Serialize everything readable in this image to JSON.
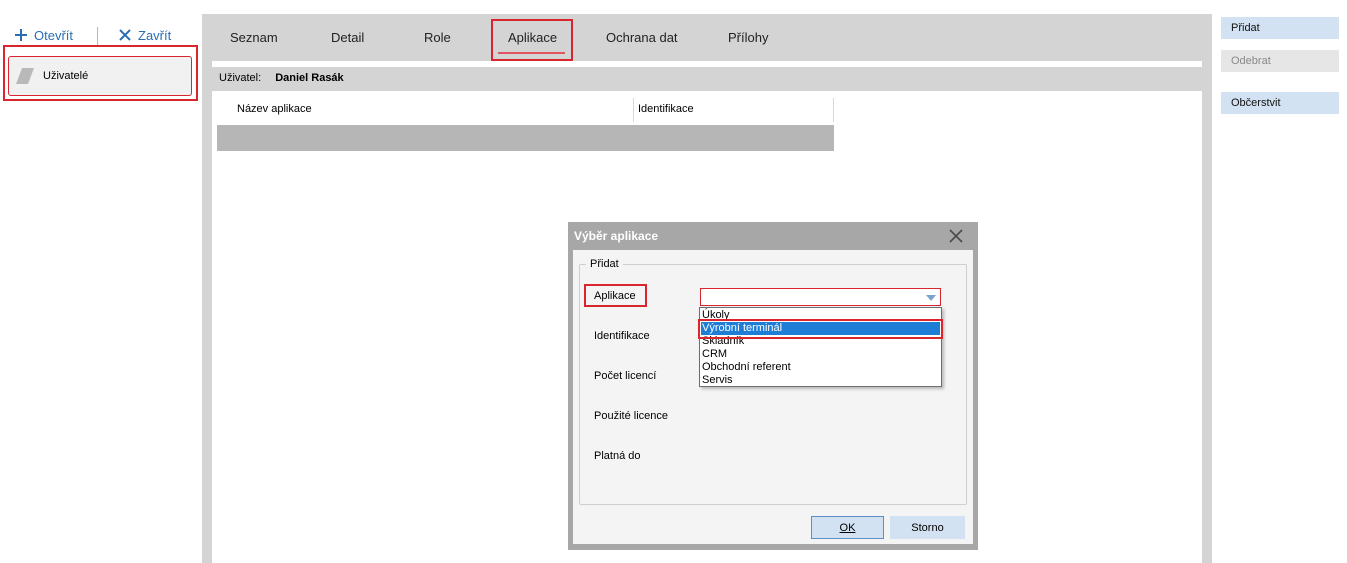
{
  "toolbar": {
    "open_label": "Otevřít",
    "close_label": "Zavřít"
  },
  "sidebar": {
    "items": [
      {
        "label": "Uživatelé",
        "selected": true
      }
    ]
  },
  "tabs": [
    {
      "label": "Seznam",
      "active": false
    },
    {
      "label": "Detail",
      "active": false
    },
    {
      "label": "Role",
      "active": false
    },
    {
      "label": "Aplikace",
      "active": true
    },
    {
      "label": "Ochrana dat",
      "active": false
    },
    {
      "label": "Přílohy",
      "active": false
    }
  ],
  "user_bar": {
    "label": "Uživatel:",
    "name": "Daniel Rasák"
  },
  "grid": {
    "columns": [
      "Název aplikace",
      "Identifikace"
    ]
  },
  "right_panel": {
    "add_label": "Přidat",
    "remove_label": "Odebrat",
    "refresh_label": "Občerstvit"
  },
  "dialog": {
    "title": "Výběr aplikace",
    "group_label": "Přidat",
    "fields": {
      "application": "Aplikace",
      "identification": "Identifikace",
      "license_count": "Počet licencí",
      "used_licenses": "Použité licence",
      "valid_until": "Platná do"
    },
    "combo_value": "",
    "options": [
      "Úkoly",
      "Výrobní terminál",
      "Skladník",
      "CRM",
      "Obchodní referent",
      "Servis"
    ],
    "selected_option": "Výrobní terminál",
    "ok_label": "OK",
    "cancel_label": "Storno"
  },
  "colors": {
    "accent_blue": "#2a6db3",
    "highlight_red": "#d8262f",
    "selection_blue": "#1e7ed6",
    "button_blue": "#d2e2f2"
  }
}
